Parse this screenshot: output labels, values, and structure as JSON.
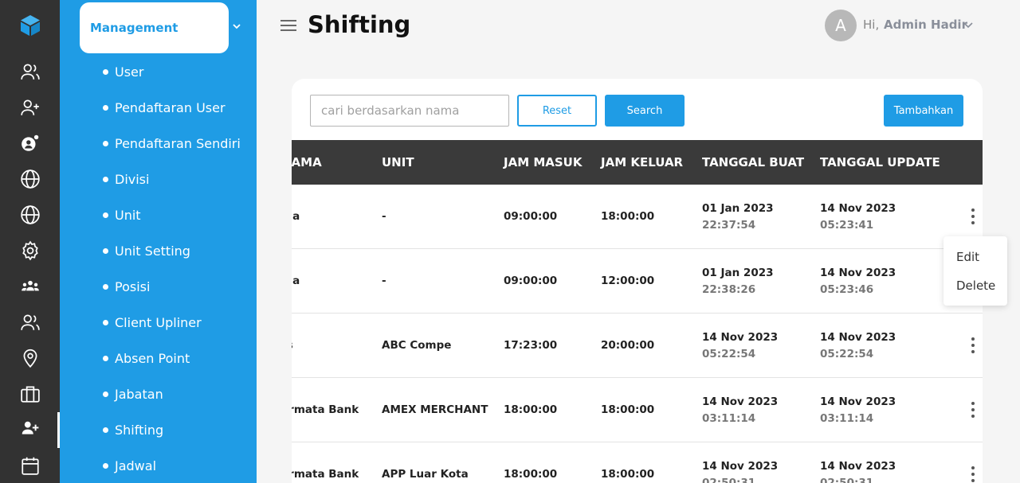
{
  "page": {
    "title": "Shifting"
  },
  "header": {
    "avatar_letter": "A",
    "greeting": "Hi,",
    "username": "Admin Hadir"
  },
  "rail": {
    "icons": [
      "cube-logo-icon",
      "users-icon",
      "user-plus-icon",
      "user-gear-icon",
      "globe-icon",
      "globe-icon",
      "gear-icon",
      "group-icon",
      "users-icon",
      "location-pin-icon",
      "briefcase-icon",
      "user-add-icon",
      "calendar-icon"
    ]
  },
  "submenu": {
    "section": "Management",
    "items": [
      "User",
      "Pendaftaran User",
      "Pendaftaran Sendiri",
      "Divisi",
      "Unit",
      "Unit Setting",
      "Posisi",
      "Client Upliner",
      "Absen Point",
      "Jabatan",
      "Shifting",
      "Jadwal"
    ]
  },
  "toolbar": {
    "search_placeholder": "cari berdasarkan nama",
    "reset_label": "Reset",
    "search_label": "Search",
    "add_label": "Tambahkan"
  },
  "table": {
    "headers": [
      "NAMA",
      "UNIT",
      "JAM MASUK",
      "JAM KELUAR",
      "TANGGAL BUAT",
      "TANGGAL UPDATE"
    ],
    "rows": [
      {
        "nama": "ma",
        "unit": "-",
        "masuk": "09:00:00",
        "keluar": "18:00:00",
        "buat_date": "01 Jan 2023",
        "buat_time": "22:37:54",
        "update_date": "14 Nov 2023",
        "update_time": "05:23:41"
      },
      {
        "nama": "ma",
        "unit": "-",
        "masuk": "09:00:00",
        "keluar": "12:00:00",
        "buat_date": "01 Jan 2023",
        "buat_time": "22:38:26",
        "update_date": "14 Nov 2023",
        "update_time": "05:23:46"
      },
      {
        "nama": "rs",
        "unit": "ABC Compe",
        "masuk": "17:23:00",
        "keluar": "20:00:00",
        "buat_date": "14 Nov 2023",
        "buat_time": "05:22:54",
        "update_date": "14 Nov 2023",
        "update_time": "05:22:54"
      },
      {
        "nama": "ermata Bank",
        "unit": "AMEX MERCHANT",
        "masuk": "18:00:00",
        "keluar": "18:00:00",
        "buat_date": "14 Nov 2023",
        "buat_time": "03:11:14",
        "update_date": "14 Nov 2023",
        "update_time": "03:11:14"
      },
      {
        "nama": "ermata Bank",
        "unit": "APP Luar Kota",
        "masuk": "18:00:00",
        "keluar": "18:00:00",
        "buat_date": "14 Nov 2023",
        "buat_time": "02:50:31",
        "update_date": "14 Nov 2023",
        "update_time": "02:50:31"
      }
    ]
  },
  "row_menu": {
    "edit_label": "Edit",
    "delete_label": "Delete"
  },
  "colors": {
    "accent": "#1f9ce5",
    "rail": "#323232",
    "table_header": "#3a3a3a"
  }
}
